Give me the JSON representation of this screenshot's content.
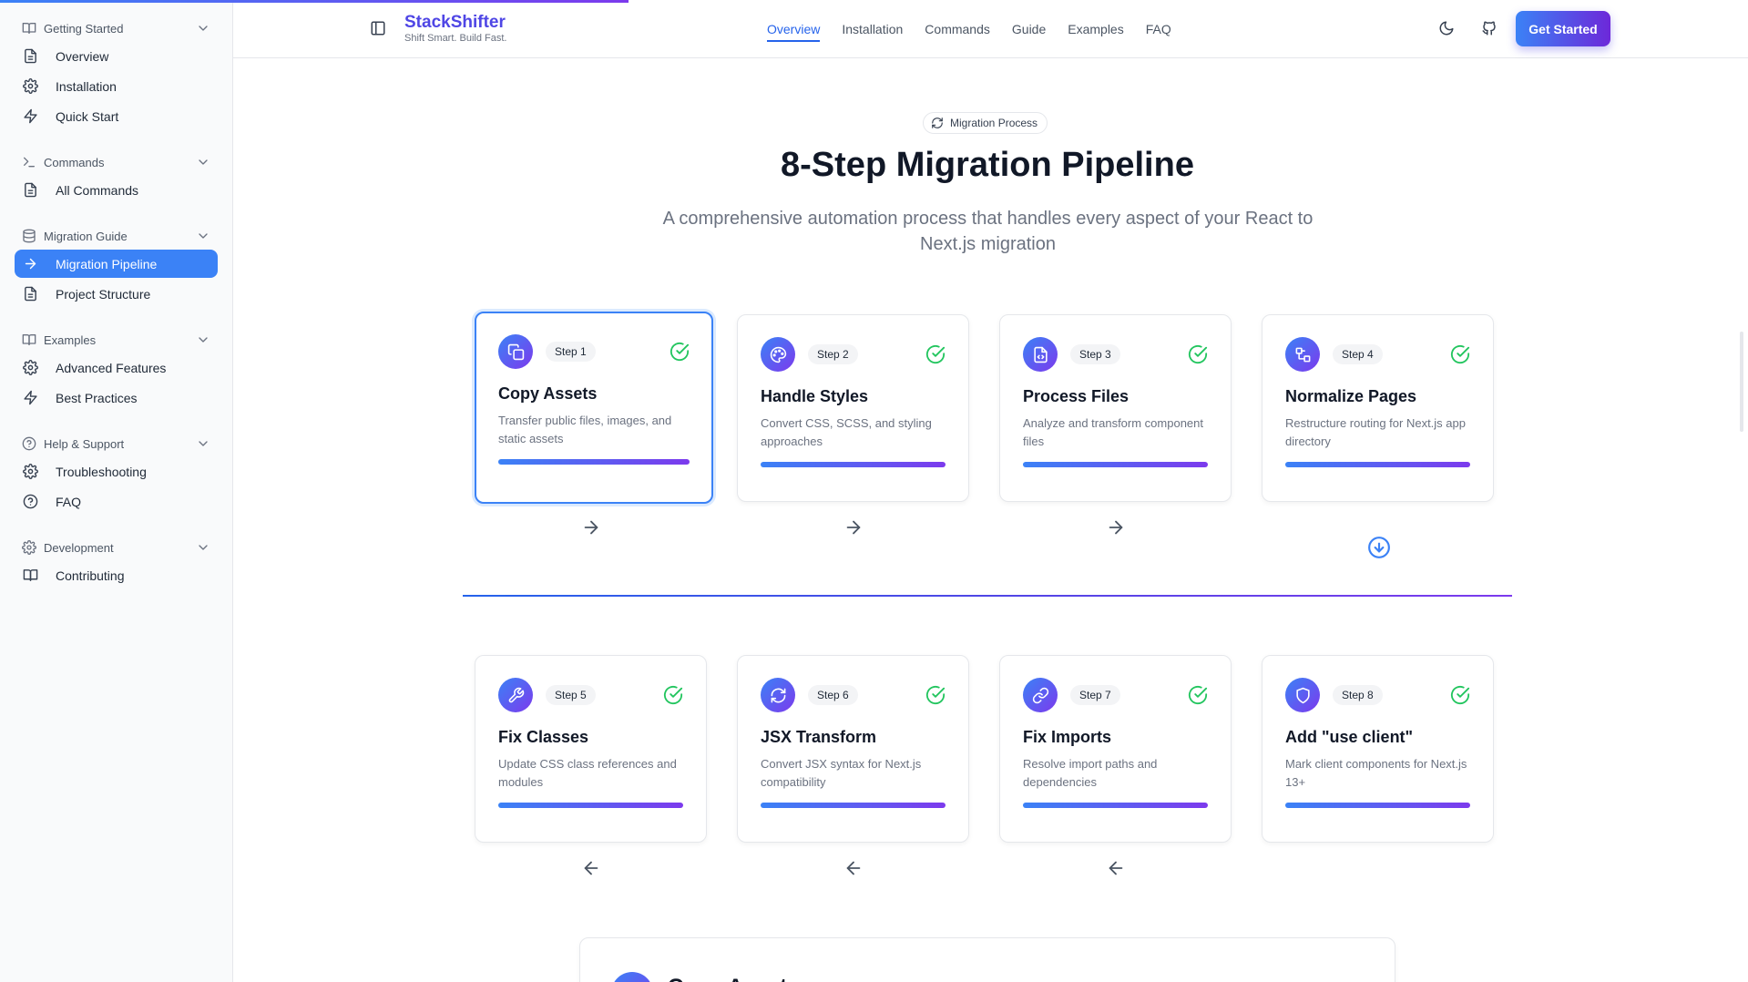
{
  "brand": {
    "title": "StackShifter",
    "tagline": "Shift Smart. Build Fast."
  },
  "nav": [
    "Overview",
    "Installation",
    "Commands",
    "Guide",
    "Examples",
    "FAQ"
  ],
  "nav_active": "Overview",
  "header": {
    "cta_label": "Get Started",
    "theme_icon": "moon-icon",
    "repo_icon": "github-icon"
  },
  "sidebar": [
    {
      "label": "Getting Started",
      "icon": "book-icon",
      "items": [
        {
          "label": "Overview",
          "icon": "file-icon"
        },
        {
          "label": "Installation",
          "icon": "gear-icon"
        },
        {
          "label": "Quick Start",
          "icon": "zap-icon"
        }
      ]
    },
    {
      "label": "Commands",
      "icon": "terminal-icon",
      "items": [
        {
          "label": "All Commands",
          "icon": "file-icon"
        }
      ]
    },
    {
      "label": "Migration Guide",
      "icon": "database-icon",
      "items": [
        {
          "label": "Migration Pipeline",
          "icon": "arrow-right-icon",
          "active": true
        },
        {
          "label": "Project Structure",
          "icon": "file-icon"
        }
      ]
    },
    {
      "label": "Examples",
      "icon": "book-icon",
      "items": [
        {
          "label": "Advanced Features",
          "icon": "gear-icon"
        },
        {
          "label": "Best Practices",
          "icon": "zap-icon"
        }
      ]
    },
    {
      "label": "Help & Support",
      "icon": "help-circle-icon",
      "items": [
        {
          "label": "Troubleshooting",
          "icon": "gear-icon"
        },
        {
          "label": "FAQ",
          "icon": "help-circle-icon"
        }
      ]
    },
    {
      "label": "Development",
      "icon": "gear-icon",
      "items": [
        {
          "label": "Contributing",
          "icon": "book-icon"
        }
      ]
    }
  ],
  "section": {
    "badge": "Migration Process",
    "title": "8-Step Migration Pipeline",
    "subtitle": "A comprehensive automation process that handles every aspect of your React to Next.js migration"
  },
  "steps": [
    {
      "step": "Step 1",
      "title": "Copy Assets",
      "desc": "Transfer public files, images, and static assets",
      "icon": "copy-icon",
      "completed": true,
      "selected": true
    },
    {
      "step": "Step 2",
      "title": "Handle Styles",
      "desc": "Convert CSS, SCSS, and styling approaches",
      "icon": "palette-icon",
      "completed": true
    },
    {
      "step": "Step 3",
      "title": "Process Files",
      "desc": "Analyze and transform component files",
      "icon": "file-code-icon",
      "completed": true
    },
    {
      "step": "Step 4",
      "title": "Normalize Pages",
      "desc": "Restructure routing for Next.js app directory",
      "icon": "route-icon",
      "completed": true
    },
    {
      "step": "Step 5",
      "title": "Fix Classes",
      "desc": "Update CSS class references and modules",
      "icon": "wrench-icon",
      "completed": true
    },
    {
      "step": "Step 6",
      "title": "JSX Transform",
      "desc": "Convert JSX syntax for Next.js compatibility",
      "icon": "refresh-icon",
      "completed": true
    },
    {
      "step": "Step 7",
      "title": "Fix Imports",
      "desc": "Resolve import paths and dependencies",
      "icon": "link-icon",
      "completed": true
    },
    {
      "step": "Step 8",
      "title": "Add \"use client\"",
      "desc": "Mark client components for Next.js 13+",
      "icon": "shield-icon",
      "completed": true
    }
  ],
  "detail": {
    "title": "Copy Assets"
  },
  "colors": {
    "accent": "#3b82f6",
    "brand": "#4f46e5",
    "gradient_end": "#7c3aed",
    "success": "#22c55e"
  }
}
